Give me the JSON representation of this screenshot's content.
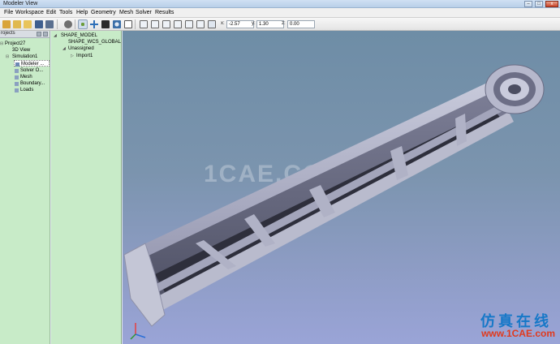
{
  "window": {
    "title": "Modeler View"
  },
  "menu": [
    "File",
    "Workspace",
    "Edit",
    "Tools",
    "Help",
    "Geometry",
    "Mesh",
    "Solver",
    "Results"
  ],
  "coords": {
    "x_label": "x:",
    "x_value": "-2.57",
    "y_label": "y:",
    "y_value": "1.30",
    "z_label": "z:",
    "z_value": "0.00"
  },
  "projects_panel": {
    "title": "rojects",
    "items": [
      "Project27",
      "3D View",
      "Simulation1",
      "Modeler ...",
      "Solver O...",
      "Mesh",
      "Boundary...",
      "Loads"
    ]
  },
  "model_panel": {
    "items": [
      "SHAPE_MODEL",
      "SHAPE_WCS_GLOBAL",
      "Unassigned",
      "Import1"
    ]
  },
  "viewport": {
    "watermark": "1CAE.COM",
    "brand_cn": "仿真在线",
    "brand_url": "www.1CAE.com"
  }
}
